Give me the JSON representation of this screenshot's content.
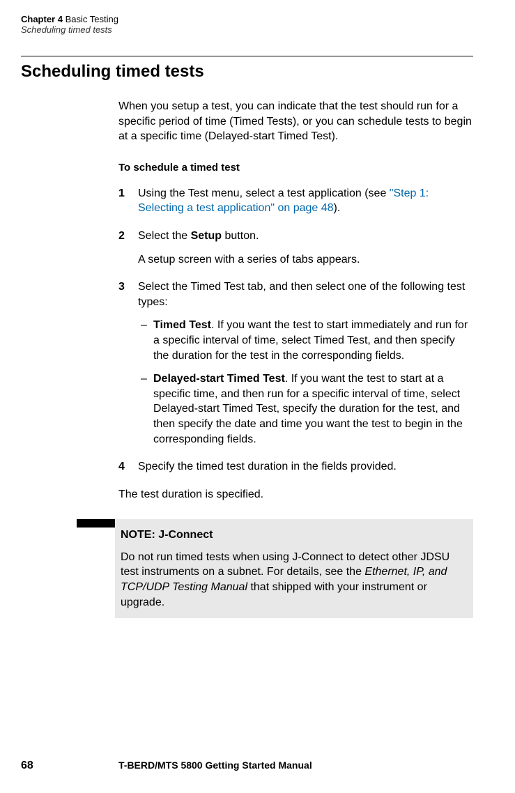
{
  "header": {
    "chapter_num": "Chapter 4",
    "chapter_title": "Basic Testing",
    "subtitle": "Scheduling timed tests"
  },
  "section_title": "Scheduling timed tests",
  "intro": "When you setup a test, you can indicate that the test should run for a specific period of time (Timed Tests), or you can schedule tests to begin at a specific time (Delayed-start Timed Test).",
  "sub_heading": "To schedule a timed test",
  "steps": {
    "s1": {
      "num": "1",
      "text_before_link": "Using the Test menu, select a test application (see ",
      "link": "\"Step 1: Selecting a test application\" on page 48",
      "text_after_link": ")."
    },
    "s2": {
      "num": "2",
      "text_before_bold": "Select the ",
      "bold": "Setup",
      "text_after_bold": " button.",
      "sub": "A setup screen with a series of tabs appears."
    },
    "s3": {
      "num": "3",
      "text": "Select the Timed Test tab, and then select one of the following test types:",
      "b1": {
        "dash": "–",
        "title": "Timed Test",
        "body": ". If you want the test to start immediately and run for a specific interval of time, select Timed Test, and then specify the duration for the test in the corresponding fields."
      },
      "b2": {
        "dash": "–",
        "title": "Delayed-start Timed Test",
        "body": ". If you want the test to start at a specific time, and then run for a specific interval of time, select Delayed-start Timed Test, specify the duration for the test, and then specify the date and time you want the test to begin in the corresponding fields."
      }
    },
    "s4": {
      "num": "4",
      "text": "Specify the timed test duration in the fields provided."
    }
  },
  "after_steps": "The test duration is specified.",
  "note": {
    "title": "NOTE: J-Connect",
    "text_before_italic": "Do not run timed tests when using J-Connect to detect other JDSU test instruments on a subnet. For details, see the ",
    "italic": "Ethernet, IP, and TCP/UDP Testing Manual",
    "text_after_italic": " that shipped with your instrument or upgrade."
  },
  "footer": {
    "page_num": "68",
    "title": "T-BERD/MTS 5800 Getting Started Manual"
  }
}
